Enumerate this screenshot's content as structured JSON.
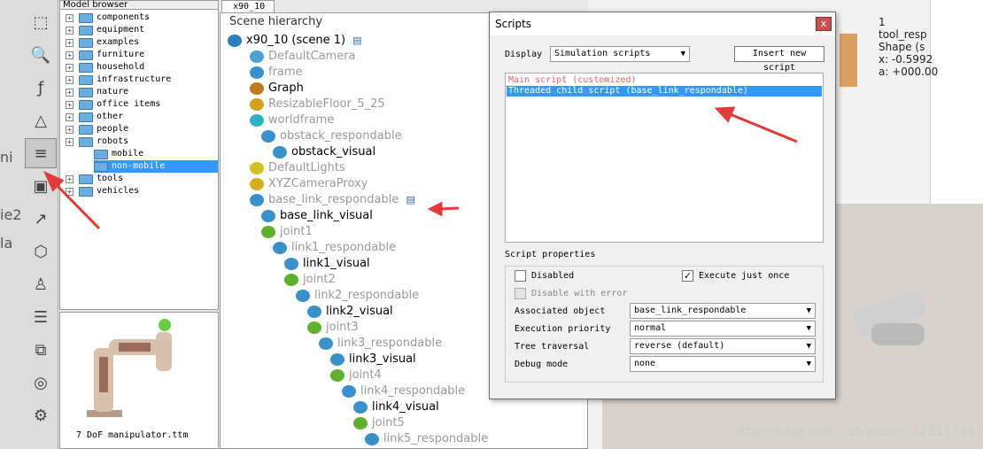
{
  "left_text": [
    "ni",
    "ie2",
    "la"
  ],
  "toolbar": {
    "icons": [
      "object-shift-icon",
      "zoom-icon",
      "function-icon",
      "shape-icon",
      "script-icon",
      "object-select-icon",
      "path-icon",
      "material-icon",
      "robot-icon",
      "list-icon",
      "layers-icon",
      "film-icon",
      "settings-user-icon"
    ]
  },
  "model_browser": {
    "title": "Model browser",
    "items": [
      {
        "label": "components",
        "level": 0,
        "expandable": true
      },
      {
        "label": "equipment",
        "level": 0,
        "expandable": true
      },
      {
        "label": "examples",
        "level": 0,
        "expandable": true
      },
      {
        "label": "furniture",
        "level": 0,
        "expandable": true
      },
      {
        "label": "household",
        "level": 0,
        "expandable": true
      },
      {
        "label": "infrastructure",
        "level": 0,
        "expandable": true
      },
      {
        "label": "nature",
        "level": 0,
        "expandable": true
      },
      {
        "label": "office items",
        "level": 0,
        "expandable": true
      },
      {
        "label": "other",
        "level": 0,
        "expandable": true
      },
      {
        "label": "people",
        "level": 0,
        "expandable": true
      },
      {
        "label": "robots",
        "level": 0,
        "expandable": true
      },
      {
        "label": "mobile",
        "level": 1,
        "expandable": false
      },
      {
        "label": "non-mobile",
        "level": 1,
        "expandable": false,
        "selected": true
      },
      {
        "label": "tools",
        "level": 0,
        "expandable": true
      },
      {
        "label": "vehicles",
        "level": 0,
        "expandable": true
      }
    ]
  },
  "thumbnail": {
    "label": "7 DoF manipulator.ttm"
  },
  "scene_tab": "x90_10",
  "scene": {
    "title": "Scene hierarchy",
    "items": [
      {
        "label": "x90_10 (scene 1)",
        "indent": 0,
        "icon": "globe-icon",
        "gray": false
      },
      {
        "label": "DefaultCamera",
        "indent": 1,
        "icon": "camera-icon",
        "gray": true
      },
      {
        "label": "frame",
        "indent": 1,
        "icon": "shape-icon",
        "gray": true
      },
      {
        "label": "Graph",
        "indent": 1,
        "icon": "graph-icon",
        "gray": false
      },
      {
        "label": "ResizableFloor_5_25",
        "indent": 1,
        "icon": "floor-icon",
        "gray": true
      },
      {
        "label": "worldframe",
        "indent": 1,
        "icon": "cube-icon",
        "gray": true
      },
      {
        "label": "obstack_respondable",
        "indent": 2,
        "icon": "shape-icon",
        "gray": true
      },
      {
        "label": "obstack_visual",
        "indent": 3,
        "icon": "shape-icon",
        "gray": false
      },
      {
        "label": "DefaultLights",
        "indent": 1,
        "icon": "light-icon",
        "gray": true
      },
      {
        "label": "XYZCameraProxy",
        "indent": 1,
        "icon": "dummy-icon",
        "gray": true
      },
      {
        "label": "base_link_respondable",
        "indent": 1,
        "icon": "shape-icon",
        "gray": true
      },
      {
        "label": "base_link_visual",
        "indent": 2,
        "icon": "shape-icon",
        "gray": false
      },
      {
        "label": "joint1",
        "indent": 2,
        "icon": "joint-icon",
        "gray": true
      },
      {
        "label": "link1_respondable",
        "indent": 3,
        "icon": "shape-icon",
        "gray": true
      },
      {
        "label": "link1_visual",
        "indent": 4,
        "icon": "shape-icon",
        "gray": false
      },
      {
        "label": "joint2",
        "indent": 4,
        "icon": "joint-icon",
        "gray": true
      },
      {
        "label": "link2_respondable",
        "indent": 5,
        "icon": "shape-icon",
        "gray": true
      },
      {
        "label": "link2_visual",
        "indent": 6,
        "icon": "shape-icon",
        "gray": false
      },
      {
        "label": "joint3",
        "indent": 6,
        "icon": "joint-icon",
        "gray": true
      },
      {
        "label": "link3_respondable",
        "indent": 7,
        "icon": "shape-icon",
        "gray": true
      },
      {
        "label": "link3_visual",
        "indent": 8,
        "icon": "shape-icon",
        "gray": false
      },
      {
        "label": "joint4",
        "indent": 8,
        "icon": "joint-icon",
        "gray": true
      },
      {
        "label": "link4_respondable",
        "indent": 9,
        "icon": "shape-icon",
        "gray": true
      },
      {
        "label": "link4_visual",
        "indent": 10,
        "icon": "shape-icon",
        "gray": false
      },
      {
        "label": "joint5",
        "indent": 10,
        "icon": "joint-icon",
        "gray": true
      },
      {
        "label": "link5_respondable",
        "indent": 11,
        "icon": "shape-icon",
        "gray": true
      }
    ]
  },
  "viewport": {
    "info_lines": [
      "1",
      "tool_resp",
      "Shape (s",
      "x: -0.5992",
      "a: +000.00"
    ],
    "watermark": "https://blog.csdn.net/weixin_42355349"
  },
  "dialog": {
    "title": "Scripts",
    "close_label": "x",
    "display_label": "Display",
    "display_value": "Simulation scripts",
    "insert_button": "Insert new script",
    "scripts": [
      {
        "label": "Main script (customized)",
        "color": "#e06666",
        "selected": false
      },
      {
        "label": "Threaded child script (base_link_respondable)",
        "color": "#ffffff",
        "selected": true
      }
    ],
    "props_label": "Script properties",
    "disabled_label": "Disabled",
    "execute_once_label": "Execute just once",
    "execute_once_checked": "✓",
    "disable_error_label": "Disable with error",
    "associated_label": "Associated object",
    "associated_value": "base_link_respondable",
    "priority_label": "Execution priority",
    "priority_value": "normal",
    "traversal_label": "Tree traversal",
    "traversal_value": "reverse (default)",
    "debug_label": "Debug mode",
    "debug_value": "none"
  },
  "colors": {
    "selection": "#3399ff",
    "annotation_red": "#e03a3a"
  }
}
